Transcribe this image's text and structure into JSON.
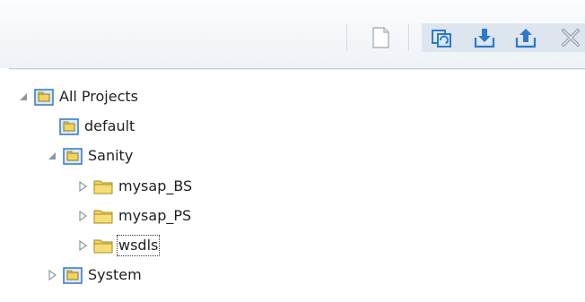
{
  "tree": {
    "root": {
      "label": "All Projects",
      "expanded": true,
      "icon": "project-folder-icon"
    },
    "items": [
      {
        "label": "default",
        "icon": "project-folder-icon"
      },
      {
        "label": "Sanity",
        "expanded": true,
        "icon": "project-folder-icon"
      },
      {
        "label": "mysap_BS",
        "expanded": false,
        "icon": "folder-icon"
      },
      {
        "label": "mysap_PS",
        "expanded": false,
        "icon": "folder-icon"
      },
      {
        "label": "wsdls",
        "expanded": false,
        "icon": "folder-icon",
        "focused": true
      },
      {
        "label": "System",
        "expanded": false,
        "icon": "project-folder-icon"
      }
    ]
  },
  "toolbar": {
    "buttons": [
      {
        "name": "new-document-icon"
      },
      {
        "name": "refresh-icon"
      },
      {
        "name": "import-icon"
      },
      {
        "name": "export-icon"
      },
      {
        "name": "delete-icon"
      }
    ]
  },
  "colors": {
    "toolbar_highlight": "#dde6ef",
    "icon_blue": "#2e79c7",
    "folder_yellow": "#f1d45c"
  }
}
